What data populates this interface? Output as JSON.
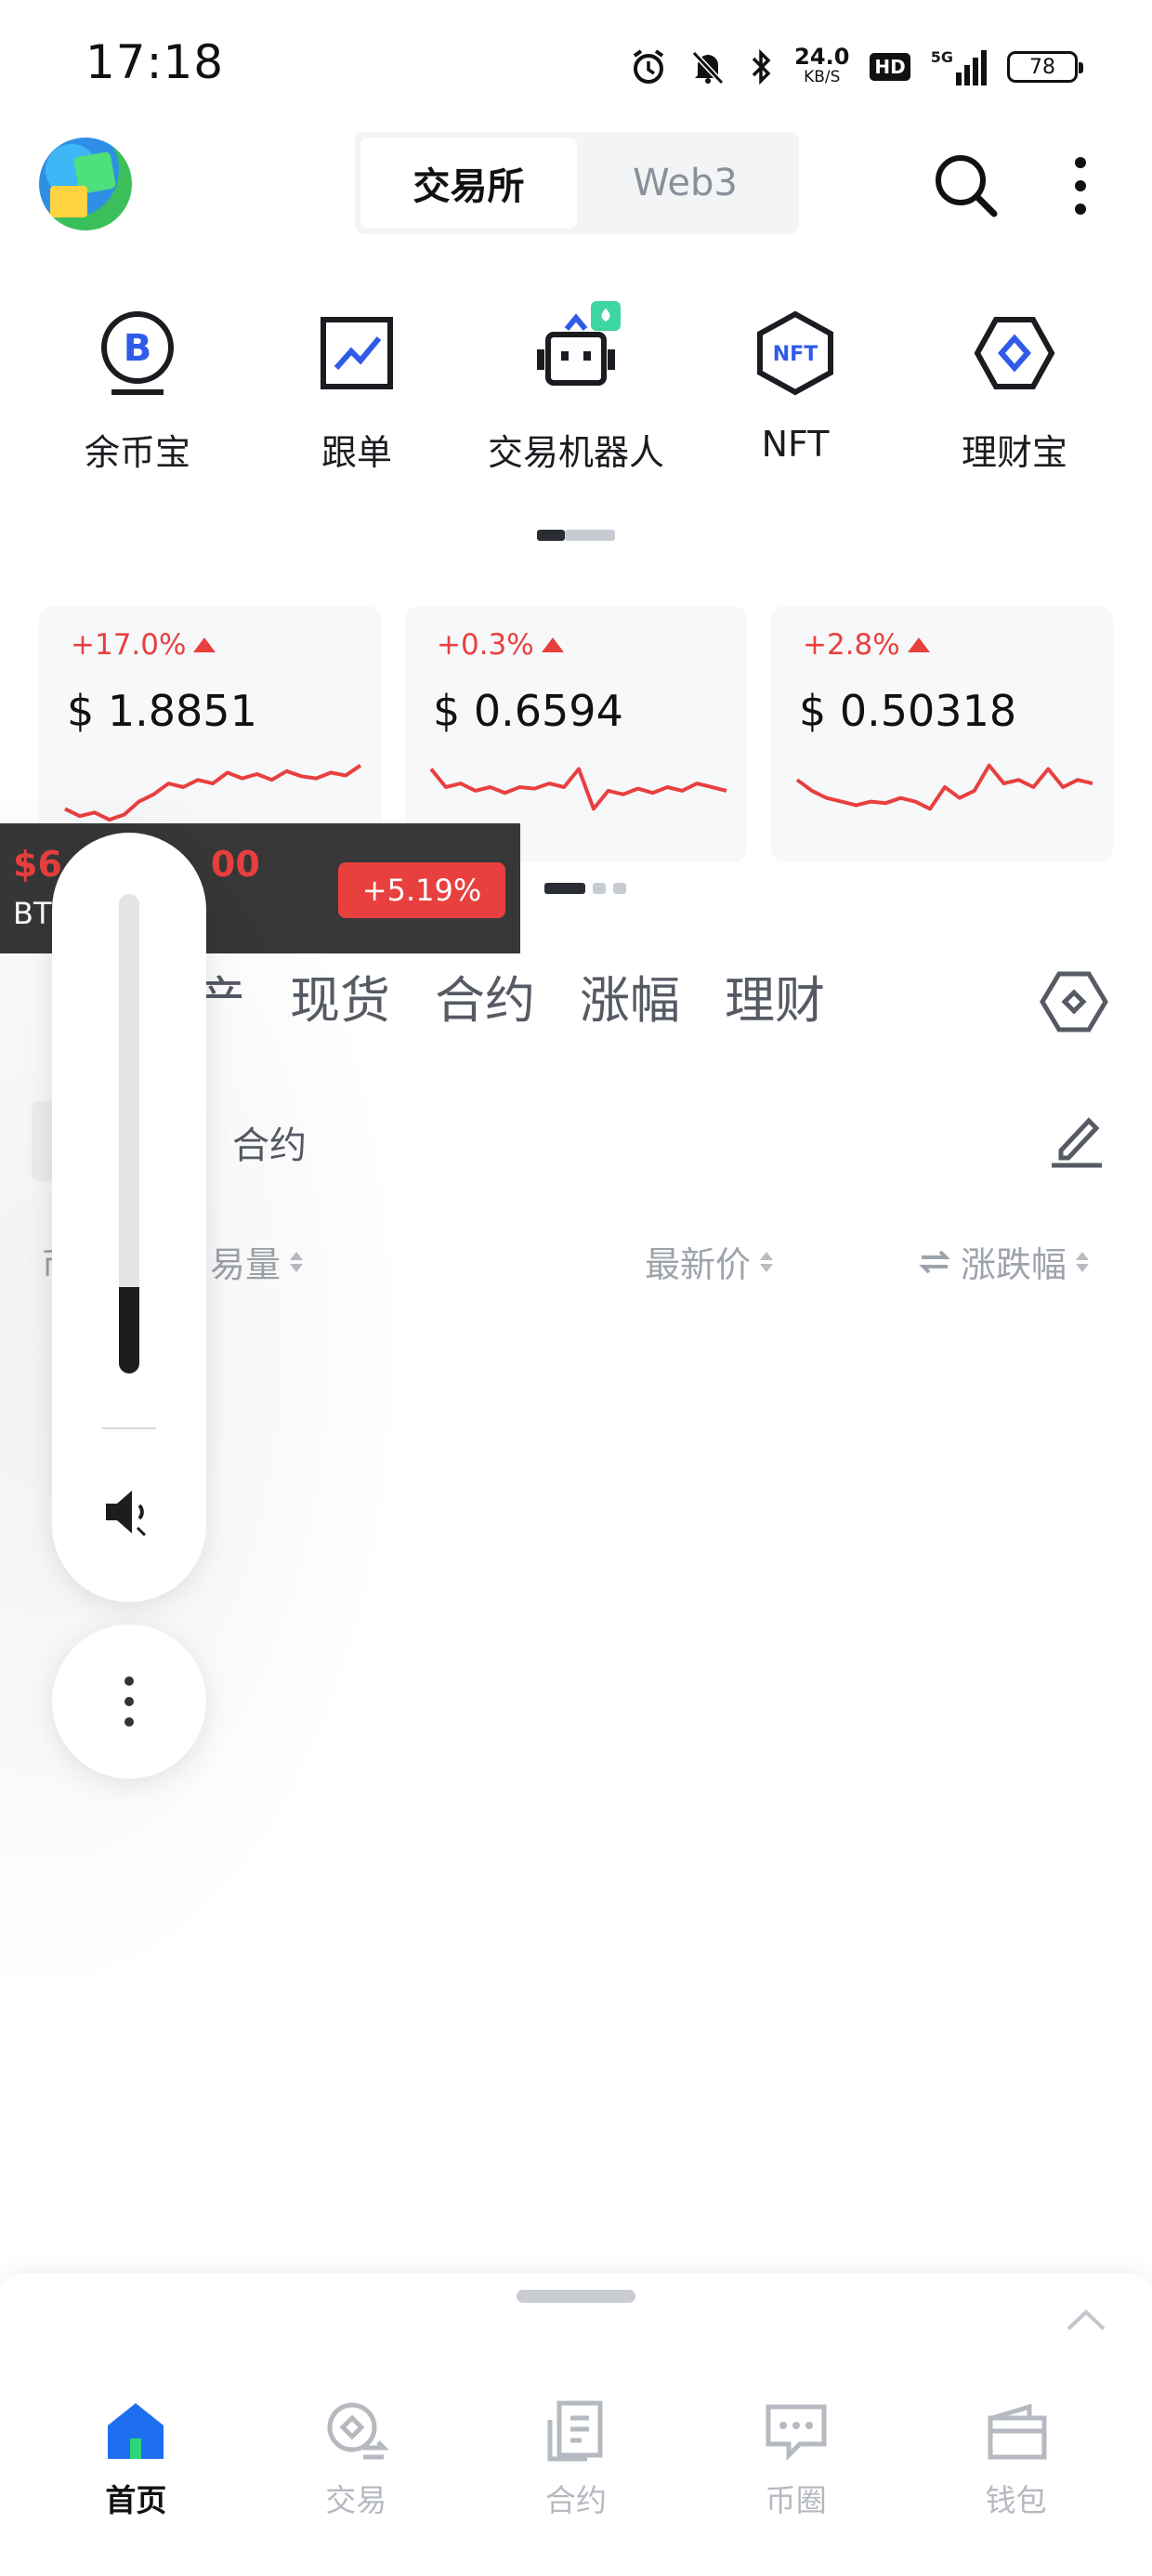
{
  "status_bar": {
    "time": "17:18",
    "net_speed_value": "24.0",
    "net_speed_unit": "KB/S",
    "hd": "HD",
    "network": "5G",
    "battery": "78"
  },
  "header": {
    "segments": [
      {
        "label": "交易所",
        "active": true
      },
      {
        "label": "Web3",
        "active": false
      }
    ],
    "search_icon": "search-icon",
    "more_icon": "more-vertical-icon"
  },
  "features": [
    {
      "label": "余币宝",
      "icon": "savings-coin-icon"
    },
    {
      "label": "跟单",
      "icon": "copy-trade-chart-icon"
    },
    {
      "label": "交易机器人",
      "icon": "trading-bot-icon"
    },
    {
      "label": "NFT",
      "icon": "nft-hexagon-icon"
    },
    {
      "label": "理财宝",
      "icon": "finance-diamond-icon"
    }
  ],
  "market_cards": [
    {
      "change": "+17.0%",
      "price": "$ 1.8851",
      "spark": [
        0.2,
        0.1,
        0.15,
        0.05,
        0.12,
        0.3,
        0.4,
        0.55,
        0.5,
        0.6,
        0.55,
        0.7,
        0.62,
        0.68,
        0.6,
        0.72,
        0.65,
        0.62,
        0.7,
        0.66,
        0.8
      ]
    },
    {
      "change": "+0.3%",
      "price": "$ 0.6594",
      "spark": [
        0.75,
        0.5,
        0.55,
        0.45,
        0.5,
        0.42,
        0.5,
        0.48,
        0.55,
        0.5,
        0.75,
        0.2,
        0.45,
        0.4,
        0.48,
        0.42,
        0.5,
        0.45,
        0.55,
        0.5,
        0.45
      ]
    },
    {
      "change": "+2.8%",
      "price": "$ 0.50318",
      "spark": [
        0.6,
        0.45,
        0.35,
        0.3,
        0.25,
        0.3,
        0.28,
        0.35,
        0.3,
        0.2,
        0.5,
        0.35,
        0.45,
        0.8,
        0.55,
        0.6,
        0.5,
        0.75,
        0.5,
        0.6,
        0.55
      ]
    }
  ],
  "market_tabs": [
    "资产",
    "现货",
    "合约",
    "涨幅",
    "理财"
  ],
  "market_tabs_visible": [
    "产",
    "现货",
    "合约",
    "涨幅",
    "理财"
  ],
  "sub_tab": "合约",
  "columns": {
    "name": "币",
    "volume": "易量",
    "price": "最新价",
    "change": "涨跌幅"
  },
  "floating_ticker": {
    "price_prefix": "$6",
    "price_suffix": "00",
    "symbol": "BT",
    "change": "+5.19%"
  },
  "volume_overlay": {
    "level": 0.18,
    "speaker_icon": "speaker-low-icon",
    "more_icon": "more-vertical-icon"
  },
  "bottom_nav": [
    {
      "label": "首页",
      "icon": "home-icon",
      "active": true
    },
    {
      "label": "交易",
      "icon": "trade-exchange-icon",
      "active": false
    },
    {
      "label": "合约",
      "icon": "contract-document-icon",
      "active": false
    },
    {
      "label": "币圈",
      "icon": "chat-bubble-icon",
      "active": false
    },
    {
      "label": "钱包",
      "icon": "wallet-icon",
      "active": false
    }
  ],
  "colors": {
    "up_red": "#e8403f",
    "accent_blue": "#2f5be8",
    "text_dark": "#1a1c21",
    "text_gray": "#9ea3ab"
  }
}
